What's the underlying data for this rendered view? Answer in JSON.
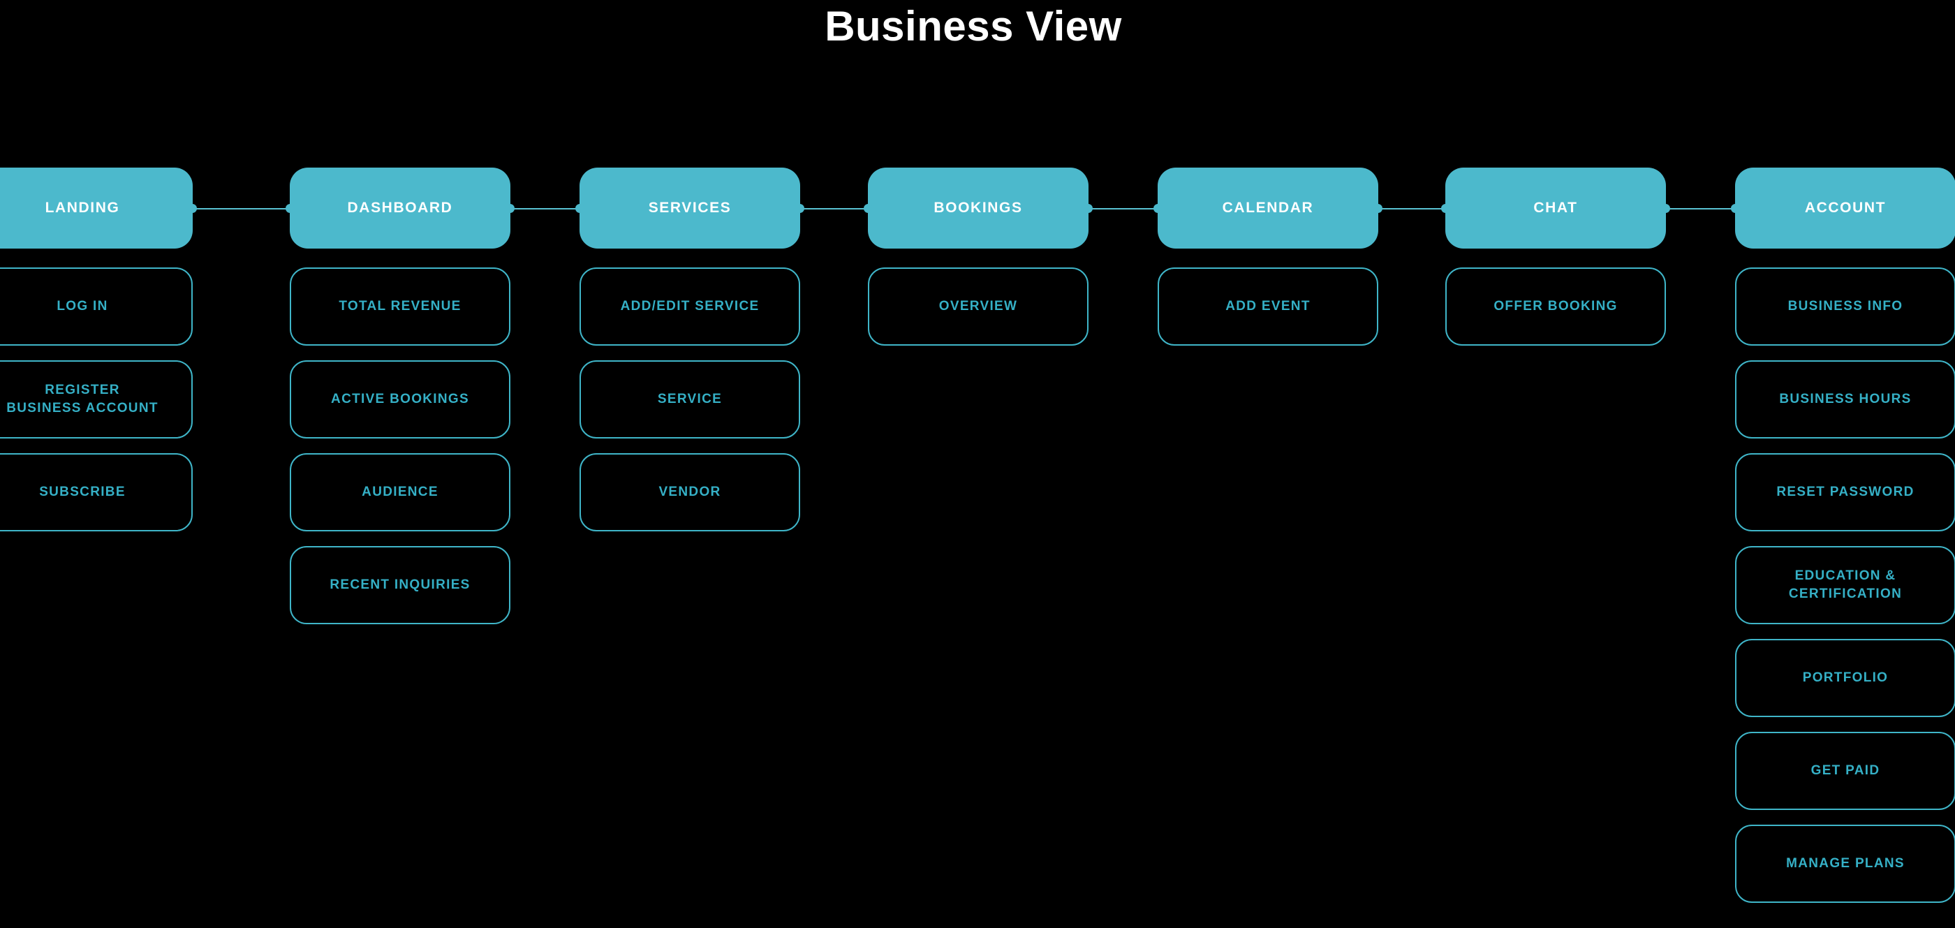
{
  "page": {
    "title": "Business View",
    "background_color": "#000000",
    "title_color": "#ffffff",
    "node_fill_color": "#4cb9cc",
    "node_border_color": "#3fb5c8",
    "node_text_color": "#35b0c6",
    "connector_color": "#59c2d2"
  },
  "diagram": {
    "type": "flowchart",
    "orientation": "horizontal-top-row-with-vertical-children",
    "columns": [
      {
        "id": "landing",
        "label": "LANDING",
        "children": [
          {
            "label": "LOG IN"
          },
          {
            "label": "REGISTER\nBUSINESS ACCOUNT"
          },
          {
            "label": "SUBSCRIBE"
          }
        ]
      },
      {
        "id": "dashboard",
        "label": "DASHBOARD",
        "children": [
          {
            "label": "TOTAL REVENUE"
          },
          {
            "label": "ACTIVE BOOKINGS"
          },
          {
            "label": "AUDIENCE"
          },
          {
            "label": "RECENT INQUIRIES"
          }
        ]
      },
      {
        "id": "services",
        "label": "SERVICES",
        "children": [
          {
            "label": "ADD/EDIT SERVICE"
          },
          {
            "label": "SERVICE"
          },
          {
            "label": "VENDOR"
          }
        ]
      },
      {
        "id": "bookings",
        "label": "BOOKINGS",
        "children": [
          {
            "label": "OVERVIEW"
          }
        ]
      },
      {
        "id": "calendar",
        "label": "CALENDAR",
        "children": [
          {
            "label": "ADD EVENT"
          }
        ]
      },
      {
        "id": "chat",
        "label": "CHAT",
        "children": [
          {
            "label": "OFFER BOOKING"
          }
        ]
      },
      {
        "id": "account",
        "label": "ACCOUNT",
        "children": [
          {
            "label": "BUSINESS INFO"
          },
          {
            "label": "BUSINESS HOURS"
          },
          {
            "label": "RESET PASSWORD"
          },
          {
            "label": "EDUCATION &\nCERTIFICATION"
          },
          {
            "label": "PORTFOLIO"
          },
          {
            "label": "GET PAID"
          },
          {
            "label": "MANAGE PLANS"
          }
        ]
      }
    ]
  }
}
